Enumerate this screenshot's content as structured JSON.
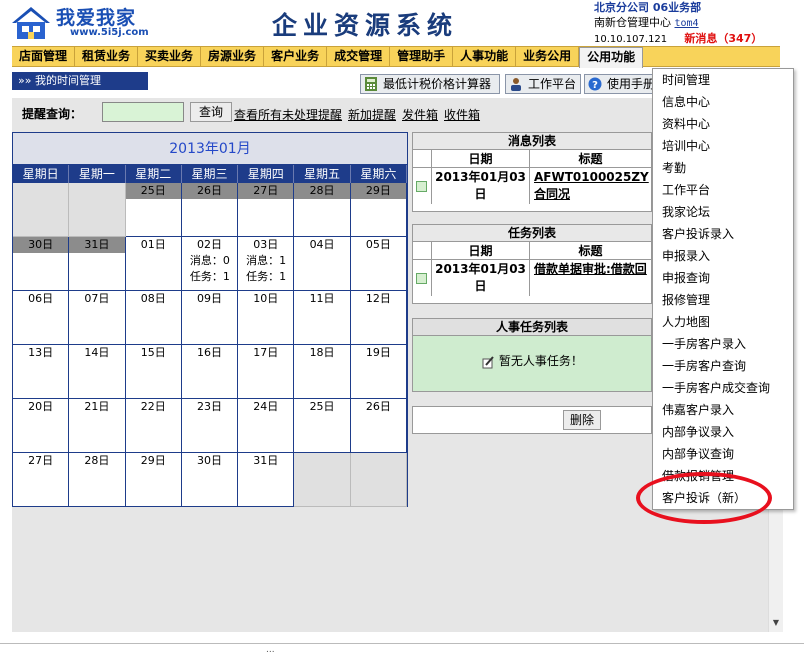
{
  "header": {
    "logo_text": "我爱我家",
    "logo_url": "www.5i5j.com",
    "system_title": "企业资源系统",
    "user_line1": "北京分公司 06业务部",
    "user_line2": "南新仓管理中心",
    "user_name": "tom4",
    "ip": "10.10.107.121",
    "new_messages": "新消息（347）"
  },
  "menu": {
    "items": [
      "店面管理",
      "租赁业务",
      "买卖业务",
      "房源业务",
      "客户业务",
      "成交管理",
      "管理助手",
      "人事功能",
      "业务公用",
      "公用功能"
    ],
    "active_index": 9
  },
  "subbar": {
    "title": "»» 我的时间管理",
    "buttons": [
      "最低计税价格计算器",
      "工作平台",
      "使用手册"
    ]
  },
  "reminder": {
    "label": "提醒查询：",
    "input_value": "",
    "search_button": "查询",
    "links": [
      "查看所有未处理提醒",
      "新加提醒",
      "发件箱",
      "收件箱"
    ]
  },
  "calendar": {
    "title": "2013年01月",
    "weekdays": [
      "星期日",
      "星期一",
      "星期二",
      "星期三",
      "星期四",
      "星期五",
      "星期六"
    ],
    "cells": [
      {
        "date": "",
        "empty": true
      },
      {
        "date": "",
        "empty": true
      },
      {
        "date": "25日",
        "grey": true
      },
      {
        "date": "26日",
        "grey": true
      },
      {
        "date": "27日",
        "grey": true
      },
      {
        "date": "28日",
        "grey": true
      },
      {
        "date": "29日",
        "grey": true
      },
      {
        "date": "30日",
        "grey": true
      },
      {
        "date": "31日",
        "grey": true
      },
      {
        "date": "01日"
      },
      {
        "date": "02日",
        "extra": [
          "消息：0",
          "任务：1"
        ]
      },
      {
        "date": "03日",
        "extra": [
          "消息：1",
          "任务：1"
        ]
      },
      {
        "date": "04日"
      },
      {
        "date": "05日"
      },
      {
        "date": "06日"
      },
      {
        "date": "07日"
      },
      {
        "date": "08日"
      },
      {
        "date": "09日"
      },
      {
        "date": "10日"
      },
      {
        "date": "11日"
      },
      {
        "date": "12日"
      },
      {
        "date": "13日"
      },
      {
        "date": "14日"
      },
      {
        "date": "15日"
      },
      {
        "date": "16日"
      },
      {
        "date": "17日"
      },
      {
        "date": "18日"
      },
      {
        "date": "19日"
      },
      {
        "date": "20日"
      },
      {
        "date": "21日"
      },
      {
        "date": "22日"
      },
      {
        "date": "23日"
      },
      {
        "date": "24日"
      },
      {
        "date": "25日"
      },
      {
        "date": "26日"
      },
      {
        "date": "27日"
      },
      {
        "date": "28日"
      },
      {
        "date": "29日"
      },
      {
        "date": "30日"
      },
      {
        "date": "31日"
      },
      {
        "date": "",
        "empty": true
      },
      {
        "date": "",
        "empty": true
      }
    ]
  },
  "messages": {
    "title": "消息列表",
    "col_date": "日期",
    "col_title": "标题",
    "row_date": "2013年01月03日",
    "row_title": "AFWT0100025ZY合同况"
  },
  "tasks": {
    "title": "任务列表",
    "col_date": "日期",
    "col_title": "标题",
    "row_date": "2013年01月03日",
    "row_title": "借款单据审批:借款回"
  },
  "hr_tasks": {
    "title": "人事任务列表",
    "empty_text": "暂无人事任务！"
  },
  "actions": {
    "delete_button": "删除"
  },
  "dropdown": {
    "items": [
      "时间管理",
      "信息中心",
      "资料中心",
      "培训中心",
      "考勤",
      "工作平台",
      "我家论坛",
      "客户投诉录入",
      "申报录入",
      "申报查询",
      "报修管理",
      "人力地图",
      "一手房客户录入",
      "一手房客户查询",
      "一手房客户成交查询",
      "伟嘉客户录入",
      "内部争议录入",
      "内部争议查询",
      "借款报销管理",
      "客户投诉（新）"
    ]
  },
  "colors": {
    "menu_bg": "#f8d35a",
    "header_blue": "#1e3c8a",
    "annotation_red": "#e8101e",
    "new_msg_red": "#e01010",
    "green_panel": "#cfeccf"
  },
  "icons": {
    "calculator": "calculator-icon",
    "workbench": "person-icon",
    "help": "help-icon",
    "hr_empty": "pen-icon"
  }
}
